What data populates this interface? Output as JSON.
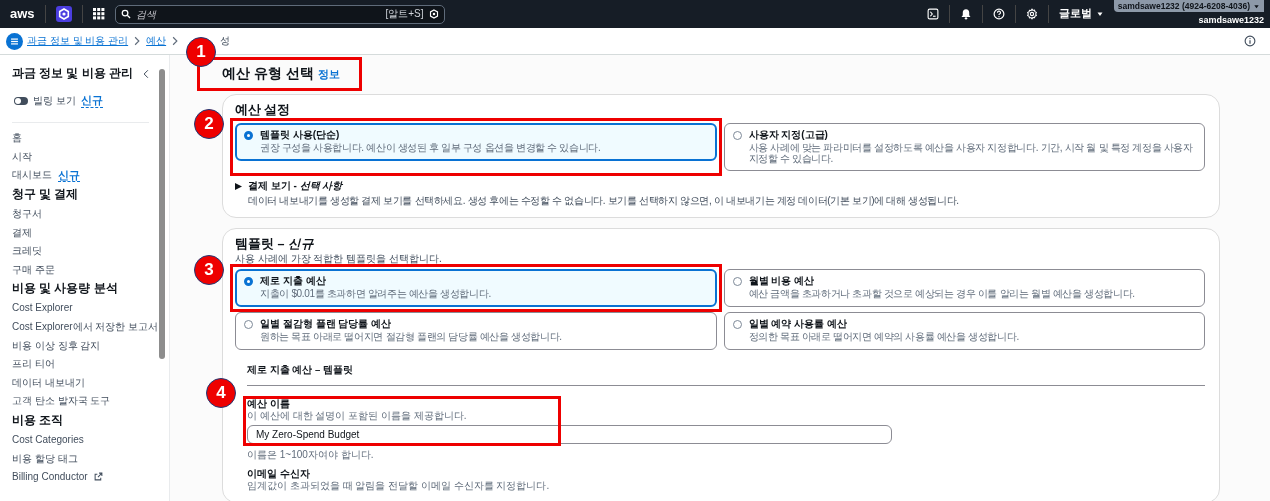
{
  "topnav": {
    "logo": "aws",
    "search": {
      "placeholder": "검색",
      "shortcut": "[알트+S]"
    },
    "region": "글로벌",
    "account": "samdsawe1232 (4924-6208-4036)",
    "user": "samdsawe1232"
  },
  "breadcrumb": {
    "links": [
      "과금 정보 및 비용 관리",
      "예산"
    ],
    "current": "성"
  },
  "sidebar": {
    "title": "과금 정보 및 비용 관리",
    "toggle": {
      "label": "빌링 보기",
      "badge": "신규",
      "on": false
    },
    "items": [
      {
        "kind": "link",
        "label": "홈"
      },
      {
        "kind": "link",
        "label": "시작"
      },
      {
        "kind": "link",
        "label": "대시보드",
        "badge": "신규"
      },
      {
        "kind": "heading",
        "label": "청구 및 결제"
      },
      {
        "kind": "link",
        "label": "청구서"
      },
      {
        "kind": "link",
        "label": "결제"
      },
      {
        "kind": "link",
        "label": "크레딧"
      },
      {
        "kind": "link",
        "label": "구매 주문"
      },
      {
        "kind": "heading",
        "label": "비용 및 사용량 분석"
      },
      {
        "kind": "link",
        "label": "Cost Explorer"
      },
      {
        "kind": "link",
        "label": "Cost Explorer에서 저장한 보고서"
      },
      {
        "kind": "link",
        "label": "비용 이상 징후 감지"
      },
      {
        "kind": "link",
        "label": "프리 티어"
      },
      {
        "kind": "link",
        "label": "데이터 내보내기"
      },
      {
        "kind": "link",
        "label": "고객 탄소 발자국 도구"
      },
      {
        "kind": "heading",
        "label": "비용 조직"
      },
      {
        "kind": "link",
        "label": "Cost Categories"
      },
      {
        "kind": "link",
        "label": "비용 할당 태그"
      },
      {
        "kind": "link",
        "label": "Billing Conductor",
        "external": true
      }
    ]
  },
  "page": {
    "title": "예산 유형 선택",
    "info": "정보",
    "step": "1"
  },
  "settings": {
    "title": "예산 설정",
    "options": [
      {
        "title": "템플릿 사용(단순)",
        "description": "권장 구성을 사용합니다. 예산이 생성된 후 일부 구성 옵션을 변경할 수 있습니다.",
        "selected": true,
        "step": "2"
      },
      {
        "title": "사용자 지정(고급)",
        "description": "사용 사례에 맞는 파라미터를 설정하도록 예산을 사용자 지정합니다. 기간, 시작 월 및 특정 계정을 사용자 지정할 수 있습니다.",
        "selected": false
      }
    ],
    "expander": {
      "label": "결제 보기 - *선택 사항*",
      "expanded": false,
      "description": "데이터 내보내기를 생성할 결제 보기를 선택하세요. 생성 후에는 수정할 수 없습니다. 보기를 선택하지 않으면, 이 내보내기는 계정 데이터(기본 보기)에 대해 생성됩니다."
    }
  },
  "templates": {
    "title": "템플릿 – *신규*",
    "description": "사용 사례에 가장 적합한 템플릿을 선택합니다.",
    "options": [
      {
        "title": "제로 지출 예산",
        "description": "지출이 $0.01를 초과하면 알려주는 예산을 생성합니다.",
        "selected": true,
        "step": "3"
      },
      {
        "title": "월별 비용 예산",
        "description": "예산 금액을 초과하거나 초과할 것으로 예상되는 경우 이를 알리는 월별 예산을 생성합니다.",
        "selected": false
      },
      {
        "title": "일별 절감형 플랜 담당률 예산",
        "description": "원하는 목표 아래로 떨어지면 절감형 플랜의 담당률 예산을 생성합니다.",
        "selected": false
      },
      {
        "title": "일별 예약 사용률 예산",
        "description": "정의한 목표 아래로 떨어지면 예약의 사용률 예산을 생성합니다.",
        "selected": false
      }
    ],
    "section_title": "제로 지출 예산 – 템플릿",
    "name_field": {
      "label": "예산 이름",
      "description": "이 예산에 대한 설명이 포함된 이름을 제공합니다.",
      "value": "My Zero-Spend Budget",
      "hint": "이름은 1~100자여야 합니다.",
      "step": "4"
    },
    "email_field": {
      "label": "이메일 수신자",
      "description": "임계값이 초과되었을 때 알림을 전달할 이메일 수신자를 지정합니다."
    }
  }
}
